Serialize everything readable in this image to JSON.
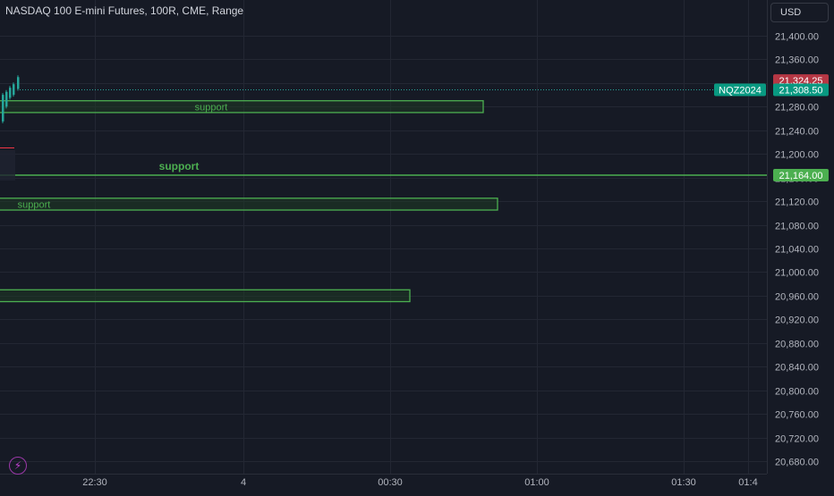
{
  "header": {
    "title": "NASDAQ 100 E-mini Futures, 100R, CME, Range",
    "currency": "USD"
  },
  "icons": {
    "alert": "lightning-bolt-icon"
  },
  "colors": {
    "background": "#161a25",
    "grid": "#232733",
    "zone_border": "#4caf50",
    "zone_fill": "#1f3b25",
    "zone_label": "#4caf50",
    "candle_up": "#26a69a",
    "price_tag_current": "#089981",
    "price_tag_red": "#b63744",
    "symbol_tag": "#089981",
    "axis_text": "#b2b5be"
  },
  "chart_data": {
    "type": "line",
    "title": "NASDAQ 100 E-mini Futures, 100R, CME, Range",
    "ylim": [
      20660,
      21420
    ],
    "y_ticks": [
      "21,400.00",
      "21,360.00",
      "21,320.00",
      "21,280.00",
      "21,240.00",
      "21,200.00",
      "21,160.00",
      "21,120.00",
      "21,080.00",
      "21,040.00",
      "21,000.00",
      "20,960.00",
      "20,920.00",
      "20,880.00",
      "20,840.00",
      "20,800.00",
      "20,760.00",
      "20,720.00",
      "20,680.00"
    ],
    "x_ticks": [
      "22:30",
      "4",
      "00:30",
      "01:00",
      "01:30",
      "01:4"
    ],
    "grid": true,
    "price_labels": {
      "red_tag": "21,324.25",
      "symbol": "NQZ2024",
      "current": "21,308.50",
      "support_line": "21,164.00"
    },
    "zones": [
      {
        "label": "support",
        "top": 21290,
        "bottom": 21270
      },
      {
        "label": "support",
        "top": 21125,
        "bottom": 21105
      },
      {
        "label": "",
        "top": 20970,
        "bottom": 20950
      }
    ],
    "support_line": {
      "label": "support",
      "value": 21164.0
    }
  }
}
